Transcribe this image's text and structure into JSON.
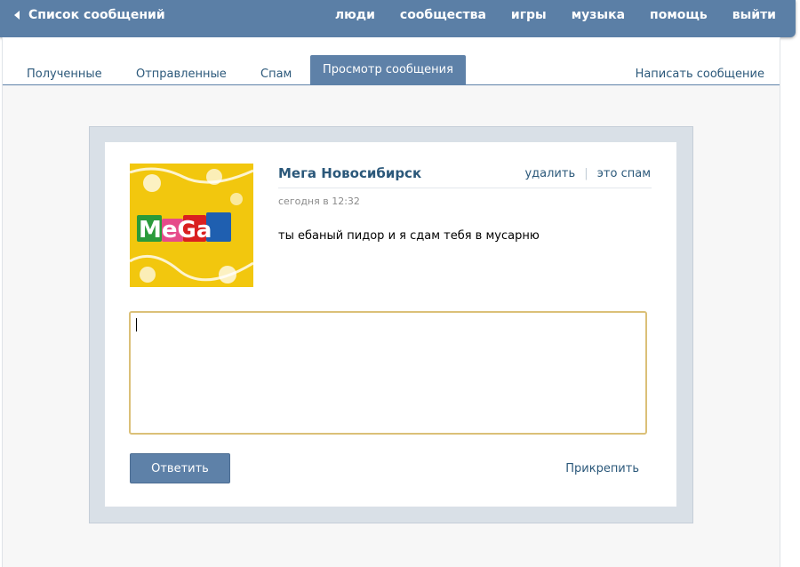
{
  "topbar": {
    "back_label": "Список сообщений",
    "nav": [
      "люди",
      "сообщества",
      "игры",
      "музыка",
      "помощь",
      "выйти"
    ]
  },
  "tabs": {
    "items": [
      "Полученные",
      "Отправленные",
      "Спам",
      "Просмотр сообщения"
    ],
    "active": "Просмотр сообщения",
    "write": "Написать сообщение"
  },
  "message": {
    "avatar_text": "MeGa",
    "sender": "Мега Новосибирск",
    "delete_label": "удалить",
    "separator": "|",
    "spam_label": "это спам",
    "timestamp": "сегодня в 12:32",
    "body": "ты ебаный пидор и я сдам тебя в мусарню"
  },
  "reply": {
    "value": "",
    "button_label": "Ответить",
    "attach_label": "Прикрепить"
  },
  "colors": {
    "topbar": "#5b7fa6",
    "accent": "#5e81a8",
    "link": "#2b587a",
    "input_border": "#dbc078"
  }
}
